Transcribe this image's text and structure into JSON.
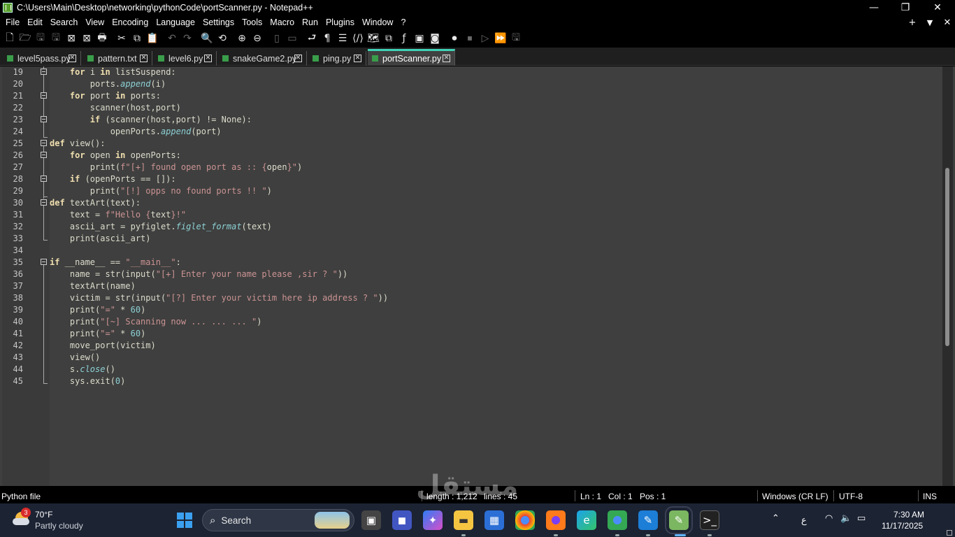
{
  "window": {
    "title": "C:\\Users\\Main\\Desktop\\networking\\pythonCode\\portScanner.py - Notepad++",
    "minimize": "—",
    "restore": "❐",
    "close": "✕"
  },
  "menu": [
    "File",
    "Edit",
    "Search",
    "View",
    "Encoding",
    "Language",
    "Settings",
    "Tools",
    "Macro",
    "Run",
    "Plugins",
    "Window",
    "?"
  ],
  "menu_right": {
    "plus": "+",
    "down": "▼",
    "close": "✕"
  },
  "tabs": [
    {
      "label": "level5pass.py",
      "active": false
    },
    {
      "label": "pattern.txt",
      "active": false
    },
    {
      "label": "level6.py",
      "active": false
    },
    {
      "label": "snakeGame2.py",
      "active": false
    },
    {
      "label": "ping.py",
      "active": false
    },
    {
      "label": "portScanner.py",
      "active": true
    }
  ],
  "editor": {
    "line_numbers": [
      "19",
      "20",
      "21",
      "22",
      "23",
      "24",
      "25",
      "26",
      "27",
      "28",
      "29",
      "30",
      "31",
      "32",
      "33",
      "34",
      "35",
      "36",
      "37",
      "38",
      "39",
      "40",
      "41",
      "42",
      "43",
      "44",
      "45"
    ]
  },
  "status": {
    "filetype": "Python file",
    "length": "length : 1,212",
    "lines": "lines : 45",
    "ln": "Ln : 1",
    "col": "Col : 1",
    "pos": "Pos : 1",
    "eol": "Windows (CR LF)",
    "encoding": "UTF-8",
    "mode": "INS"
  },
  "taskbar": {
    "weather_badge": "3",
    "weather_temp": "70°F",
    "weather_desc": "Partly cloudy",
    "search_label": "Search",
    "lang": "ع",
    "time": "7:30 AM",
    "date": "11/17/2025"
  },
  "watermark": "مستقل"
}
